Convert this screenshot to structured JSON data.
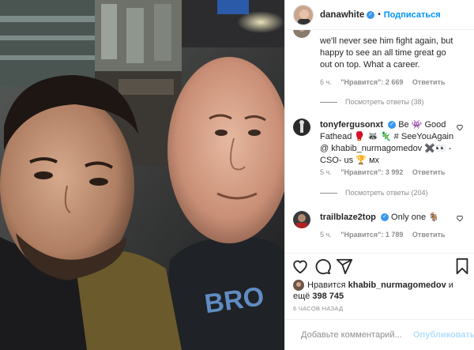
{
  "post": {
    "username": "danawhite",
    "follow_label": "Подписаться",
    "dot": "•"
  },
  "comments": [
    {
      "text": "we'll never see him fight again, but happy to see an all time great go out on top. What a career.",
      "time": "6 ч.",
      "likes": "\"Нравится\": 2 669",
      "reply": "Ответить",
      "view_replies": "Посмотреть ответы (38)"
    },
    {
      "username": "tonyfergusonxt",
      "text": "Be 👾 Good Fathead 🥊 🦝 🦎 # SeeYouAgain @ khabib_nurmagomedov ✖️👀 - CSO- us 🏆 мх",
      "time": "5 ч.",
      "likes": "\"Нравится\": 3 992",
      "reply": "Ответить",
      "view_replies": "Посмотреть ответы (204)"
    },
    {
      "username": "trailblaze2top",
      "text": "Only one 🐐",
      "time": "5 ч.",
      "likes": "\"Нравится\": 1 789",
      "reply": "Ответить"
    }
  ],
  "likes_line": {
    "prefix": "Нравится ",
    "user": "khabib_nurmagomedov",
    "suffix": " и",
    "line2_prefix": "ещё ",
    "count": "398 745"
  },
  "timestamp": "6 ЧАСОВ НАЗАД",
  "add_comment": {
    "placeholder": "Добавьте комментарий...",
    "publish_label": "Опубликовать"
  },
  "icons": {
    "like": "heart-icon",
    "comment": "comment-icon",
    "share": "share-icon",
    "save": "bookmark-icon",
    "emoji": "smiley-icon",
    "verified": "verified-badge-icon"
  },
  "colors": {
    "accent": "#0095f6",
    "verified": "#3897f0",
    "muted": "#8e8e8e",
    "publish_disabled": "#b2dffc"
  }
}
